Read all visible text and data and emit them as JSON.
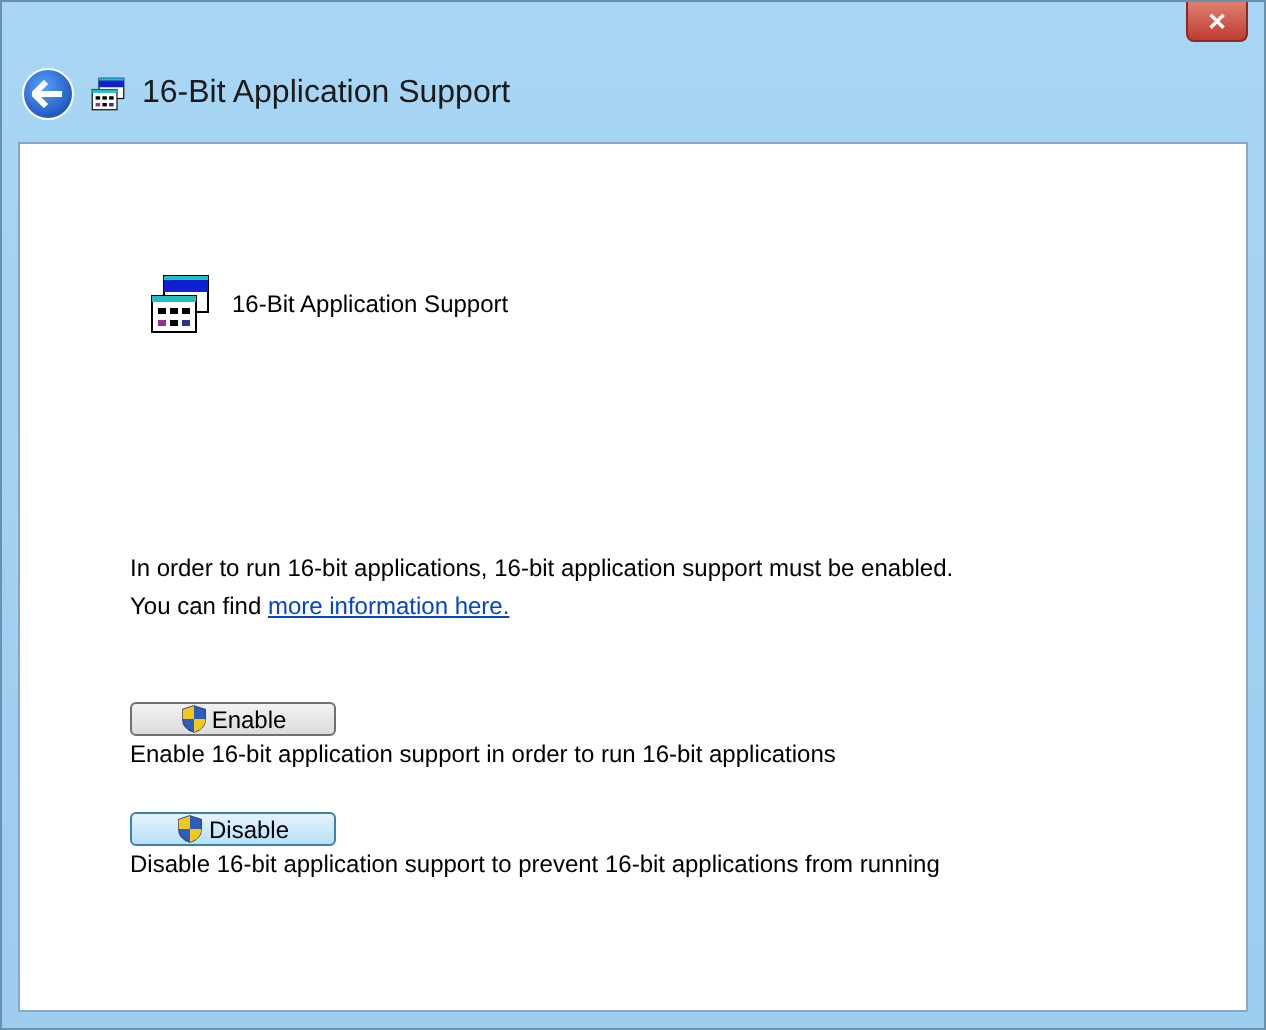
{
  "window": {
    "close": "✕",
    "title": "16-Bit Application Support"
  },
  "header": {
    "title": "16-Bit Application Support"
  },
  "info": {
    "line1": "In order to run 16-bit applications, 16-bit application support must be enabled.",
    "line2_prefix": "You can find ",
    "link": "more information here."
  },
  "actions": [
    {
      "label": "Enable",
      "focused": false,
      "description": "Enable 16-bit application support in order to run 16-bit applications"
    },
    {
      "label": "Disable",
      "focused": true,
      "description": "Disable 16-bit application support to prevent 16-bit applications from running"
    }
  ]
}
